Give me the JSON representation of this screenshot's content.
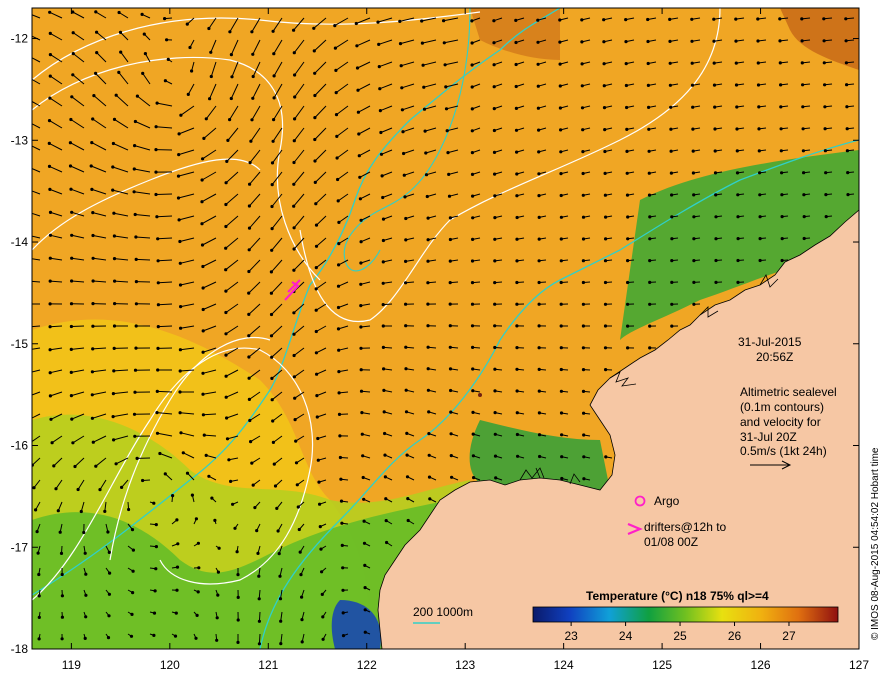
{
  "map": {
    "x_ticks": [
      "119",
      "120",
      "121",
      "122",
      "123",
      "124",
      "125",
      "126",
      "127"
    ],
    "y_ticks": [
      "-12",
      "-13",
      "-14",
      "-15",
      "-16",
      "-17",
      "-18"
    ],
    "x_range": [
      118.6,
      127
    ],
    "y_range": [
      -18,
      -11.7
    ]
  },
  "annotations": {
    "date": "31-Jul-2015",
    "time": "20:56Z",
    "altimetric": [
      "Altimetric sealevel",
      "(0.1m contours)",
      "and velocity for",
      "31-Jul 20Z",
      "0.5m/s (1kt 24h)"
    ]
  },
  "legend": {
    "argo_label": "Argo",
    "drifters_label_1": "drifters@12h to",
    "drifters_label_2": "01/08 00Z",
    "bathymetry_label": "200  1000m",
    "colorbar_title": "Temperature (°C) n18 75% ql>=4",
    "colorbar_ticks": [
      "23",
      "24",
      "25",
      "26",
      "27"
    ],
    "colorbar_range": [
      22.3,
      27.9
    ]
  },
  "credit": "© IMOS 08-Aug-2015 04:54:02 Hobart time",
  "colors": {
    "land": "#f5c6a3",
    "sea_warm": "#f0a020",
    "sea_mid": "#f4c010",
    "sea_cool": "#9ecc20",
    "sea_cold": "#28a030",
    "contour": "#ffffff",
    "bathymetry": "#30d0c8",
    "drifter": "#ff20c8"
  }
}
